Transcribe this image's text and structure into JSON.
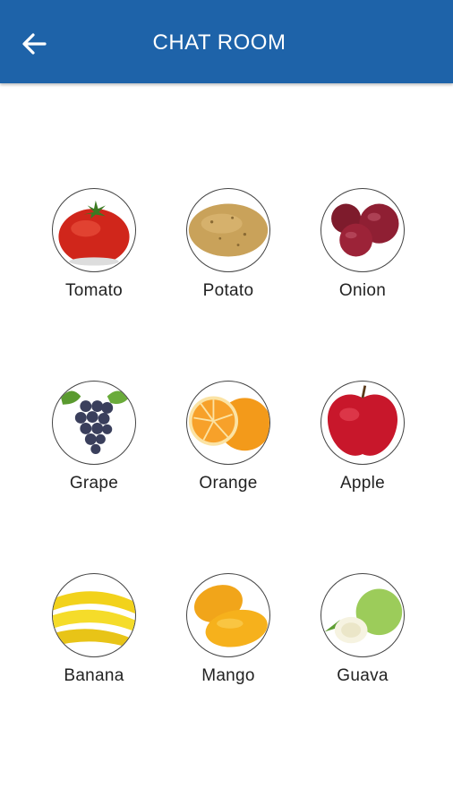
{
  "header": {
    "title": "CHAT ROOM",
    "back_icon": "arrow-left-icon",
    "background": "#1e63a9"
  },
  "items": [
    {
      "label": "Tomato",
      "icon": "tomato-image"
    },
    {
      "label": "Potato",
      "icon": "potato-image"
    },
    {
      "label": "Onion",
      "icon": "onion-image"
    },
    {
      "label": "Grape",
      "icon": "grape-image"
    },
    {
      "label": "Orange",
      "icon": "orange-image"
    },
    {
      "label": "Apple",
      "icon": "apple-image"
    },
    {
      "label": "Banana",
      "icon": "banana-image"
    },
    {
      "label": "Mango",
      "icon": "mango-image"
    },
    {
      "label": "Guava",
      "icon": "guava-image"
    }
  ]
}
